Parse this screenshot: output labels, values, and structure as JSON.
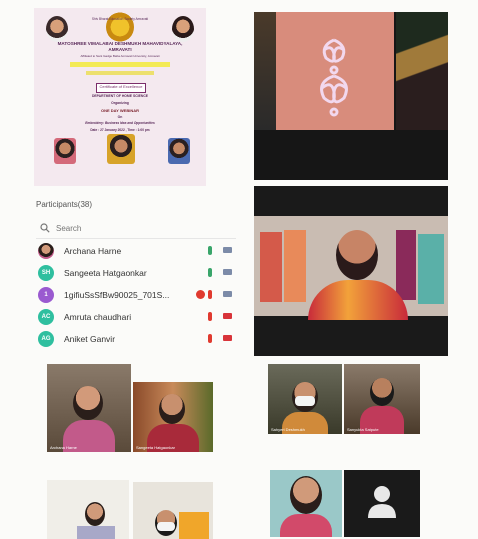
{
  "poster": {
    "org_line": "Shiv Bharat Education Society Amravati",
    "college_name": "MATOSHREE VIMALABAI DESHMUKH MAHAVIDYALAYA,",
    "city": "AMRAVATI",
    "affiliation": "Affiliated to Sant Gadge Baba Amravati University, Amravati",
    "certificate_label": "Certificate of Excellence",
    "dept_line": "DEPARTMENT OF HOME SCIENCE",
    "organizing": "Organizing",
    "event": "ONE DAY WEBINAR",
    "on": "On",
    "topic": "Embroidery: Business Idea and Opportunities",
    "date_line": "Date : 27 January 2022 , Time : 1:00 pm"
  },
  "participants": {
    "title": "Participants(38)",
    "search_placeholder": "Search",
    "list": [
      {
        "initials": "",
        "name": "Archana Harne",
        "avatar_color": "#8b5a4a",
        "photo": true,
        "mic_color": "#39a56a",
        "cam_color": "#7c8ba8",
        "alert": false
      },
      {
        "initials": "SH",
        "name": "Sangeeta Hatgaonkar",
        "avatar_color": "#2fbf9f",
        "photo": false,
        "mic_color": "#39a56a",
        "cam_color": "#7c8ba8",
        "alert": false
      },
      {
        "initials": "1",
        "name": "1gifiuSsSfBw90025_701S...",
        "avatar_color": "#9a5ad0",
        "photo": false,
        "mic_color": "#e03a2f",
        "cam_color": "#7c8ba8",
        "alert": true
      },
      {
        "initials": "AC",
        "name": "Amruta chaudhari",
        "avatar_color": "#2fbf9f",
        "photo": false,
        "mic_color": "#e03a2f",
        "cam_color": "#d8343a",
        "alert": false
      },
      {
        "initials": "AG",
        "name": "Aniket Ganvir",
        "avatar_color": "#2fbf9f",
        "photo": false,
        "mic_color": "#e03a2f",
        "cam_color": "#d8343a",
        "alert": false
      }
    ]
  },
  "tiles_left": {
    "t1": "Archana Harne",
    "t2": "Sangeeta Hatgaonkar"
  },
  "tiles_right": {
    "t1": "Sahyeri Deshmukh",
    "t2": "Sanyukta Satpute"
  }
}
